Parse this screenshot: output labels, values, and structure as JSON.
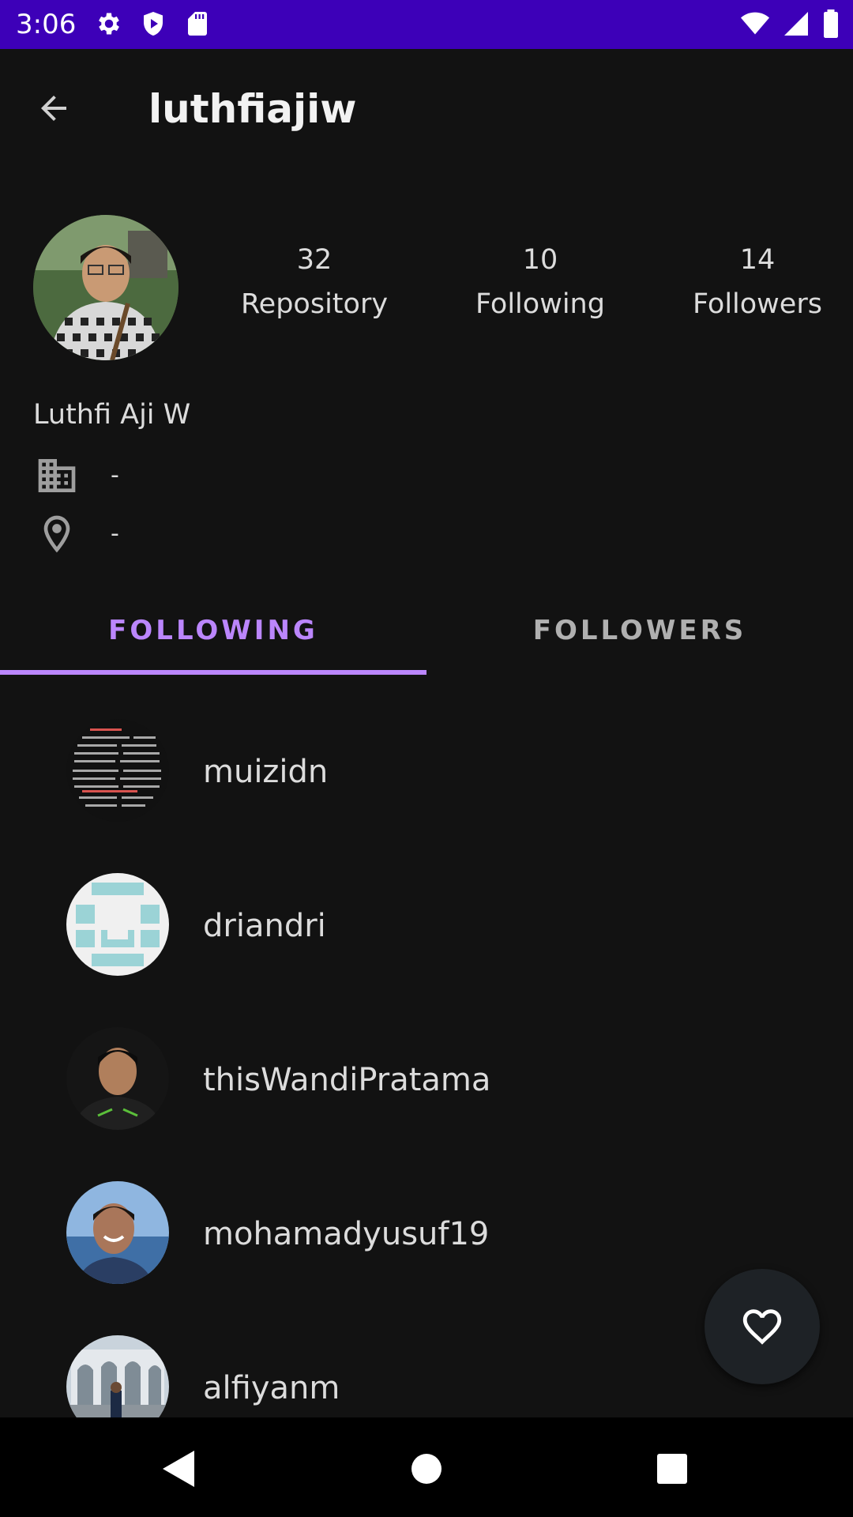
{
  "status_bar": {
    "time": "3:06",
    "left_icons": [
      "gear-icon",
      "play-shield-icon",
      "sd-card-icon"
    ],
    "right_icons": [
      "wifi-icon",
      "signal-icon",
      "battery-icon"
    ],
    "background": "#3d00b8"
  },
  "app_bar": {
    "title": "luthfiajiw",
    "back_icon": "arrow-back-icon"
  },
  "profile": {
    "full_name": "Luthfi Aji W",
    "stats": [
      {
        "value": "32",
        "label": "Repository"
      },
      {
        "value": "10",
        "label": "Following"
      },
      {
        "value": "14",
        "label": "Followers"
      }
    ],
    "company": "-",
    "location": "-"
  },
  "tabs": {
    "items": [
      {
        "label": "FOLLOWING",
        "selected": true
      },
      {
        "label": "FOLLOWERS",
        "selected": false
      }
    ],
    "accent": "#bb86fc"
  },
  "following": [
    {
      "username": "muizidn"
    },
    {
      "username": "driandri"
    },
    {
      "username": "thisWandiPratama"
    },
    {
      "username": "mohamadyusuf19"
    },
    {
      "username": "alfiyanm"
    }
  ],
  "fab": {
    "icon": "heart-outline-icon"
  },
  "nav_bar": {
    "icons": [
      "back-triangle-icon",
      "home-circle-icon",
      "recents-square-icon"
    ]
  }
}
